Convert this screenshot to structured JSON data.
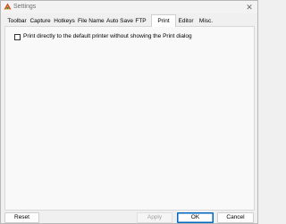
{
  "window": {
    "title": "Settings",
    "close_glyph": "✕",
    "icon": "settings-app-icon"
  },
  "tabs": [
    {
      "label": "Toolbar"
    },
    {
      "label": "Capture"
    },
    {
      "label": "Hotkeys"
    },
    {
      "label": "File Name"
    },
    {
      "label": "Auto Save"
    },
    {
      "label": "FTP"
    },
    {
      "label": "Print",
      "active": true
    },
    {
      "label": "Editor"
    },
    {
      "label": "Misc."
    }
  ],
  "print_panel": {
    "print_directly_label": "Print directly to the default printer without showing the Print dialog",
    "print_directly_checked": false
  },
  "buttons": {
    "reset": "Reset",
    "apply": "Apply",
    "ok": "OK",
    "cancel": "Cancel"
  }
}
